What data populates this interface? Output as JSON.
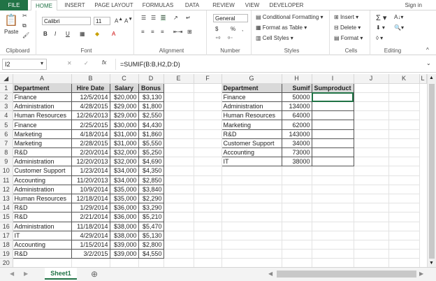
{
  "tabs": {
    "file": "FILE",
    "home": "HOME",
    "insert": "INSERT",
    "page_layout": "PAGE LAYOUT",
    "formulas": "FORMULAS",
    "data": "DATA",
    "review": "REVIEW",
    "view": "VIEW",
    "developer": "DEVELOPER",
    "signin": "Sign in"
  },
  "ribbon": {
    "clipboard": {
      "label": "Clipboard",
      "paste": "Paste"
    },
    "font": {
      "label": "Font",
      "name": "Calibri",
      "size": "11",
      "bold": "B",
      "italic": "I",
      "underline": "U"
    },
    "alignment": {
      "label": "Alignment"
    },
    "number": {
      "label": "Number",
      "format": "General",
      "currency": "$",
      "percent": "%",
      "comma": ","
    },
    "styles": {
      "label": "Styles",
      "conditional": "Conditional Formatting",
      "format_table": "Format as Table",
      "cell_styles": "Cell Styles"
    },
    "cells": {
      "label": "Cells",
      "insert": "Insert",
      "delete": "Delete",
      "format": "Format"
    },
    "editing": {
      "label": "Editing"
    }
  },
  "formula_bar": {
    "name_box": "I2",
    "fx": "fx",
    "formula": "=SUMIF(B:B,H2,D:D)"
  },
  "columns": [
    "A",
    "B",
    "C",
    "D",
    "E",
    "F",
    "G",
    "H",
    "I",
    "J",
    "K",
    "L"
  ],
  "rows": [
    {
      "n": "1",
      "a": "Department",
      "b": "Hire Date",
      "c": "Salary",
      "d": "Bonus",
      "h": "Department",
      "i": "Sumif",
      "j": "Sumproduct"
    },
    {
      "n": "2",
      "a": "Finance",
      "b": "12/5/2014",
      "c": "$20,000",
      "d": "$3,130",
      "h": "Finance",
      "i": "50000",
      "j": ""
    },
    {
      "n": "3",
      "a": "Administration",
      "b": "4/28/2015",
      "c": "$29,000",
      "d": "$1,800",
      "h": "Administration",
      "i": "134000",
      "j": ""
    },
    {
      "n": "4",
      "a": "Human Resources",
      "b": "12/26/2013",
      "c": "$29,000",
      "d": "$2,550",
      "h": "Human Resources",
      "i": "64000",
      "j": ""
    },
    {
      "n": "5",
      "a": "Finance",
      "b": "2/25/2015",
      "c": "$30,000",
      "d": "$4,430",
      "h": "Marketing",
      "i": "62000",
      "j": ""
    },
    {
      "n": "6",
      "a": "Marketing",
      "b": "4/18/2014",
      "c": "$31,000",
      "d": "$1,860",
      "h": "R&D",
      "i": "143000",
      "j": ""
    },
    {
      "n": "7",
      "a": "Marketing",
      "b": "2/28/2015",
      "c": "$31,000",
      "d": "$5,550",
      "h": "Customer Support",
      "i": "34000",
      "j": ""
    },
    {
      "n": "8",
      "a": "R&D",
      "b": "2/20/2014",
      "c": "$32,000",
      "d": "$5,250",
      "h": "Accounting",
      "i": "73000",
      "j": ""
    },
    {
      "n": "9",
      "a": "Administration",
      "b": "12/20/2013",
      "c": "$32,000",
      "d": "$4,690",
      "h": "IT",
      "i": "38000",
      "j": ""
    },
    {
      "n": "10",
      "a": "Customer Support",
      "b": "1/23/2014",
      "c": "$34,000",
      "d": "$4,350",
      "h": "",
      "i": "",
      "j": ""
    },
    {
      "n": "11",
      "a": "Accounting",
      "b": "11/20/2013",
      "c": "$34,000",
      "d": "$2,850",
      "h": "",
      "i": "",
      "j": ""
    },
    {
      "n": "12",
      "a": "Administration",
      "b": "10/9/2014",
      "c": "$35,000",
      "d": "$3,840",
      "h": "",
      "i": "",
      "j": ""
    },
    {
      "n": "13",
      "a": "Human Resources",
      "b": "12/18/2014",
      "c": "$35,000",
      "d": "$2,290",
      "h": "",
      "i": "",
      "j": ""
    },
    {
      "n": "14",
      "a": "R&D",
      "b": "1/29/2014",
      "c": "$36,000",
      "d": "$3,290",
      "h": "",
      "i": "",
      "j": ""
    },
    {
      "n": "15",
      "a": "R&D",
      "b": "2/21/2014",
      "c": "$36,000",
      "d": "$5,210",
      "h": "",
      "i": "",
      "j": ""
    },
    {
      "n": "16",
      "a": "Administration",
      "b": "11/18/2014",
      "c": "$38,000",
      "d": "$5,470",
      "h": "",
      "i": "",
      "j": ""
    },
    {
      "n": "17",
      "a": "IT",
      "b": "4/29/2014",
      "c": "$38,000",
      "d": "$5,130",
      "h": "",
      "i": "",
      "j": ""
    },
    {
      "n": "18",
      "a": "Accounting",
      "b": "1/15/2014",
      "c": "$39,000",
      "d": "$2,800",
      "h": "",
      "i": "",
      "j": ""
    },
    {
      "n": "19",
      "a": "R&D",
      "b": "3/2/2015",
      "c": "$39,000",
      "d": "$4,550",
      "h": "",
      "i": "",
      "j": ""
    },
    {
      "n": "20",
      "a": "",
      "b": "",
      "c": "",
      "d": "",
      "h": "",
      "i": "",
      "j": ""
    }
  ],
  "sheet": {
    "name": "Sheet1"
  }
}
